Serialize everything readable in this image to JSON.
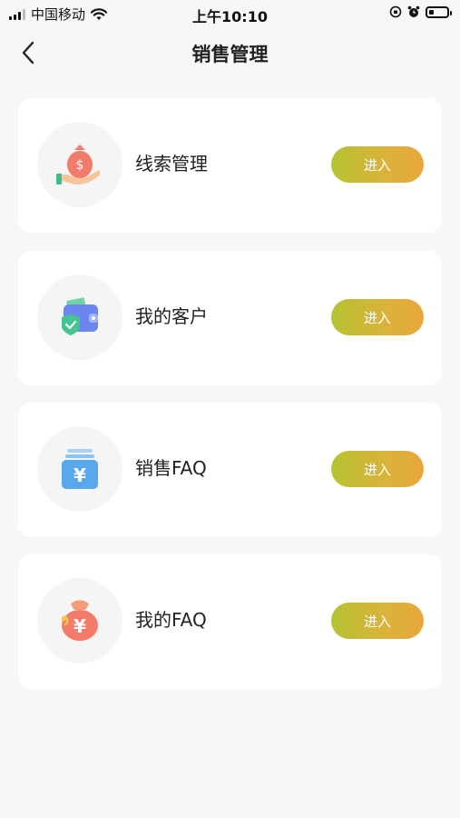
{
  "status_bar": {
    "carrier": "中国移动",
    "time": "上午10:10"
  },
  "nav": {
    "title": "销售管理",
    "back_icon": "chevron-left-icon"
  },
  "colors": {
    "background": "#f7f7f7",
    "button_gradient_start": "#b7c232",
    "button_gradient_end": "#e9a63a"
  },
  "items": [
    {
      "label": "线索管理",
      "button": "进入",
      "icon": "money-bag-hand-icon"
    },
    {
      "label": "我的客户",
      "button": "进入",
      "icon": "wallet-shield-icon"
    },
    {
      "label": "销售FAQ",
      "button": "进入",
      "icon": "yuan-card-icon"
    },
    {
      "label": "我的FAQ",
      "button": "进入",
      "icon": "yuan-bag-icon"
    }
  ]
}
